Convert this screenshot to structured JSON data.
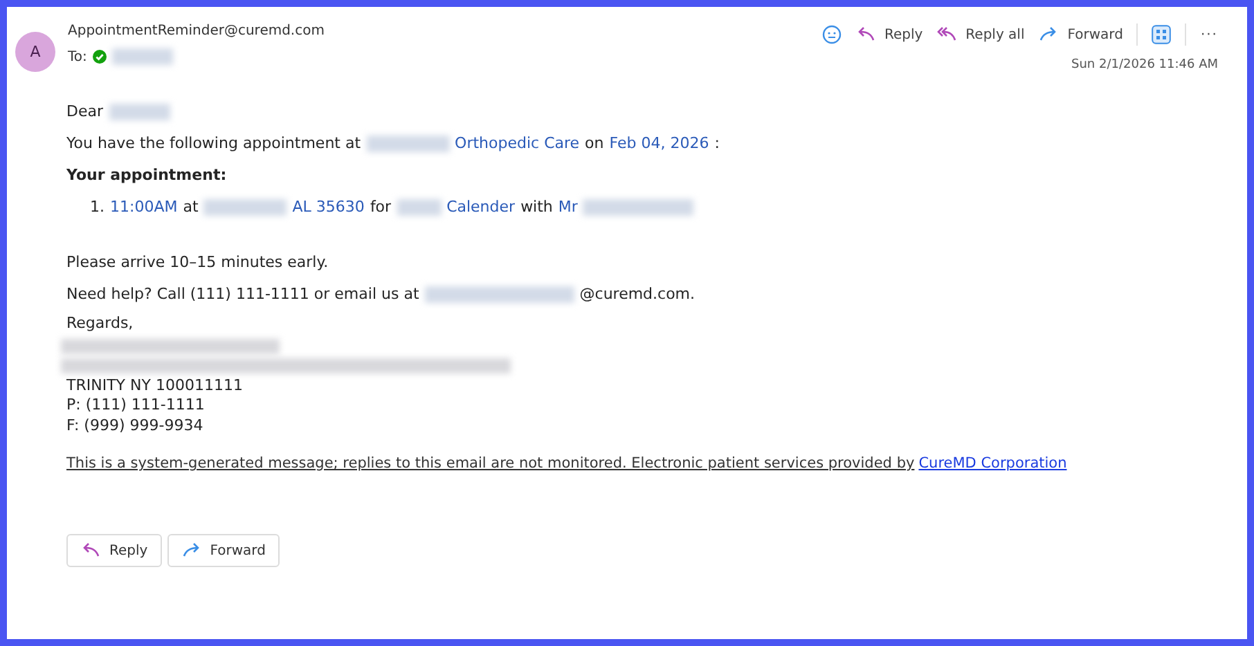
{
  "sender": {
    "avatar": "A",
    "email": "AppointmentReminder@curemd.com",
    "to_label": "To:",
    "recipient_verified": true
  },
  "actions": [
    {
      "kind": "emoji"
    },
    {
      "kind": "reply",
      "label": "Reply"
    },
    {
      "kind": "replyall",
      "label": "Reply all"
    },
    {
      "kind": "forward",
      "label": "Forward"
    },
    {
      "kind": "apps"
    },
    {
      "kind": "more",
      "label": "···"
    }
  ],
  "date": "Sun 2/1/2026 11:46 AM",
  "body": [
    {
      "kind": "para",
      "segments": [
        {
          "kind": "text",
          "text": "Dear"
        },
        {
          "kind": "redacted"
        }
      ]
    },
    {
      "kind": "para",
      "segments": [
        {
          "kind": "text",
          "text": "You have the following appointment at"
        },
        {
          "kind": "redacted"
        },
        {
          "kind": "link",
          "text": "Orthopedic Care"
        },
        {
          "kind": "text",
          "text": "on"
        },
        {
          "kind": "link",
          "text": "Feb 04, 2026"
        },
        {
          "kind": "text",
          "text": ":"
        }
      ]
    },
    {
      "kind": "heading",
      "segments": [
        {
          "kind": "text",
          "text": "Your appointment:"
        }
      ]
    },
    {
      "kind": "item",
      "number": "1.",
      "segments": [
        {
          "kind": "link",
          "text": "11:00AM"
        },
        {
          "kind": "text",
          "text": "at"
        },
        {
          "kind": "redacted"
        },
        {
          "kind": "link",
          "text": "AL 35630"
        },
        {
          "kind": "text",
          "text": "for"
        },
        {
          "kind": "redacted"
        },
        {
          "kind": "link",
          "text": "Calender"
        },
        {
          "kind": "text",
          "text": "with"
        },
        {
          "kind": "link",
          "text": "Mr"
        },
        {
          "kind": "redacted"
        }
      ]
    },
    {
      "kind": "para",
      "segments": [
        {
          "kind": "text",
          "text": "Please arrive 10–15 minutes early."
        }
      ]
    },
    {
      "kind": "para",
      "segments": [
        {
          "kind": "text",
          "text": "Need help? Call (111) 111-1111 or email us at"
        },
        {
          "kind": "redacted"
        },
        {
          "kind": "text",
          "text": "@curemd.com."
        }
      ]
    }
  ],
  "signature": [
    {
      "kind": "text",
      "text": "Regards,"
    },
    {
      "kind": "redacted"
    },
    {
      "kind": "redacted"
    },
    {
      "kind": "text",
      "text": "TRINITY NY 100011111"
    },
    {
      "kind": "text",
      "text": "P: (111) 111-1111"
    },
    {
      "kind": "text",
      "text": "F: (999) 999-9934"
    }
  ],
  "disclaimer": {
    "text": "This is a system-generated message; replies to this email are not monitored. Electronic patient services provided by",
    "link": "CureMD Corporation"
  },
  "footer_buttons": [
    {
      "kind": "reply",
      "label": "Reply"
    },
    {
      "kind": "forward",
      "label": "Forward"
    }
  ]
}
